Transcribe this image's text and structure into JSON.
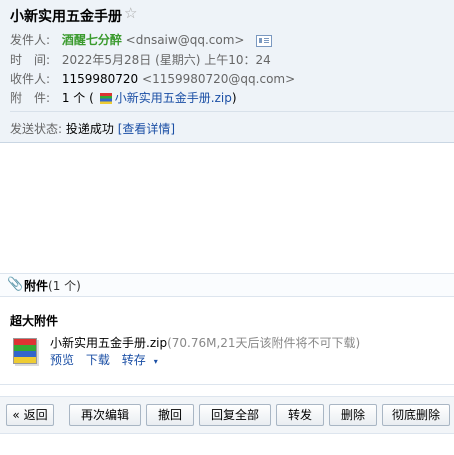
{
  "header": {
    "subject": "小新实用五金手册",
    "star_icon": "☆",
    "from_label": "发件人:",
    "from_name": "酒醒七分醉",
    "from_addr": "<dnsaiw@qq.com>",
    "time_label": "时　间:",
    "time_value": "2022年5月28日 (星期六) 上午10：24",
    "to_label": "收件人:",
    "to_name": "1159980720",
    "to_addr": "<1159980720@qq.com>",
    "attach_label": "附　件:",
    "attach_count": "1 个 (",
    "attach_file": "小新实用五金手册.zip",
    "attach_close": ")",
    "status_label": "发送状态:",
    "status_value": "投递成功",
    "status_link": "[查看详情]"
  },
  "attachments": {
    "title": "附件",
    "count": "(1 个)",
    "big_title": "超大附件",
    "file_name": "小新实用五金手册.zip",
    "file_meta": "(70.76M,21天后该附件将不可下载)",
    "preview": "预览",
    "download": "下载",
    "save": "转存",
    "caret": "▾"
  },
  "toolbar": {
    "back": "« 返回",
    "reedit": "再次编辑",
    "recall": "撤回",
    "reply_all": "回复全部",
    "forward": "转发",
    "delete": "删除",
    "delete_perm": "彻底删除"
  }
}
